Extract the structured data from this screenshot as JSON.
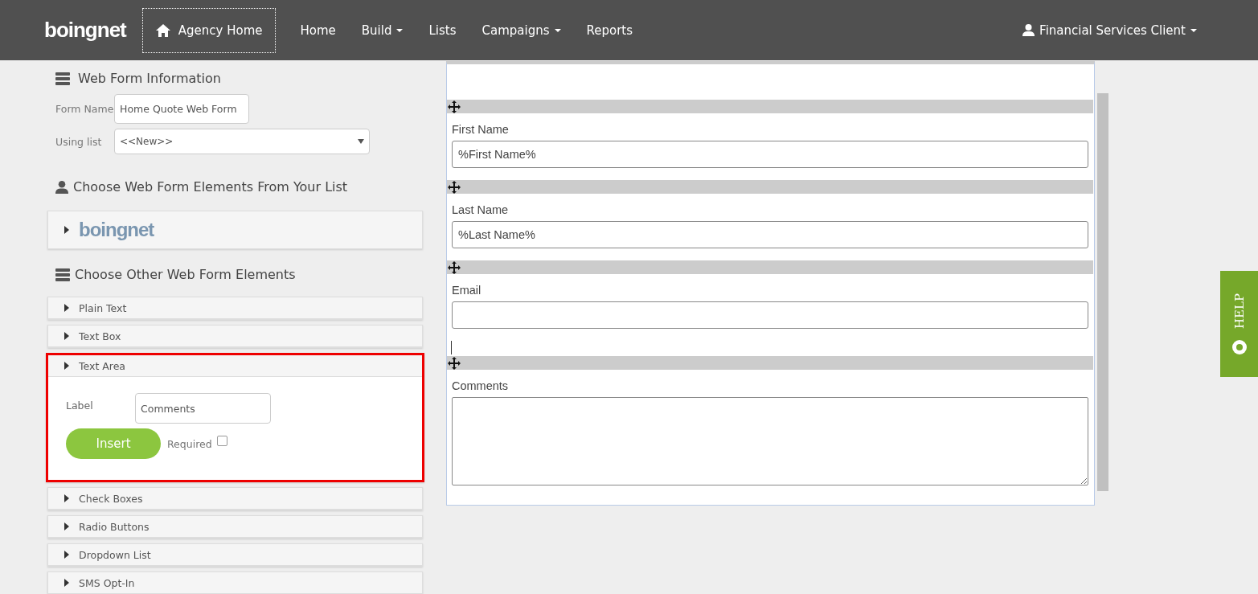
{
  "navbar": {
    "logo": "boingnet",
    "agency_home": "Agency Home",
    "items": [
      {
        "label": "Home",
        "dropdown": false
      },
      {
        "label": "Build",
        "dropdown": true
      },
      {
        "label": "Lists",
        "dropdown": false
      },
      {
        "label": "Campaigns",
        "dropdown": true
      },
      {
        "label": "Reports",
        "dropdown": false
      }
    ],
    "user": "Financial Services Client"
  },
  "web_form_information": {
    "title": "Web Form Information",
    "form_name_label": "Form Name",
    "form_name_value": "Home Quote Web Form",
    "using_list_label": "Using list",
    "using_list_value": "<<New>>"
  },
  "list_elements": {
    "title": "Choose Web Form Elements From Your List",
    "logo": "boingnet",
    "expanded": false
  },
  "other_elements": {
    "title": "Choose Other Web Form Elements",
    "items": [
      {
        "label": "Plain Text",
        "expanded": false,
        "highlighted": false
      },
      {
        "label": "Text Box",
        "expanded": false,
        "highlighted": false
      },
      {
        "label": "Text Area",
        "expanded": true,
        "highlighted": true,
        "label_caption": "Label",
        "label_value": "Comments",
        "insert_button": "Insert",
        "required_label": "Required",
        "required_checked": false
      },
      {
        "label": "Check Boxes",
        "expanded": false,
        "highlighted": false
      },
      {
        "label": "Radio Buttons",
        "expanded": false,
        "highlighted": false
      },
      {
        "label": "Dropdown List",
        "expanded": false,
        "highlighted": false
      },
      {
        "label": "SMS Opt-In",
        "expanded": false,
        "highlighted": false
      }
    ]
  },
  "preview": {
    "fields": [
      {
        "kind": "text",
        "label": "First Name",
        "value": "%First Name%",
        "cursor_after": false
      },
      {
        "kind": "text",
        "label": "Last Name",
        "value": "%Last Name%",
        "cursor_after": false
      },
      {
        "kind": "text",
        "label": "Email",
        "cursor_after": true
      },
      {
        "kind": "textarea",
        "label": "Comments",
        "cursor_after": false
      }
    ]
  },
  "help_tab": {
    "label": "HELP"
  }
}
